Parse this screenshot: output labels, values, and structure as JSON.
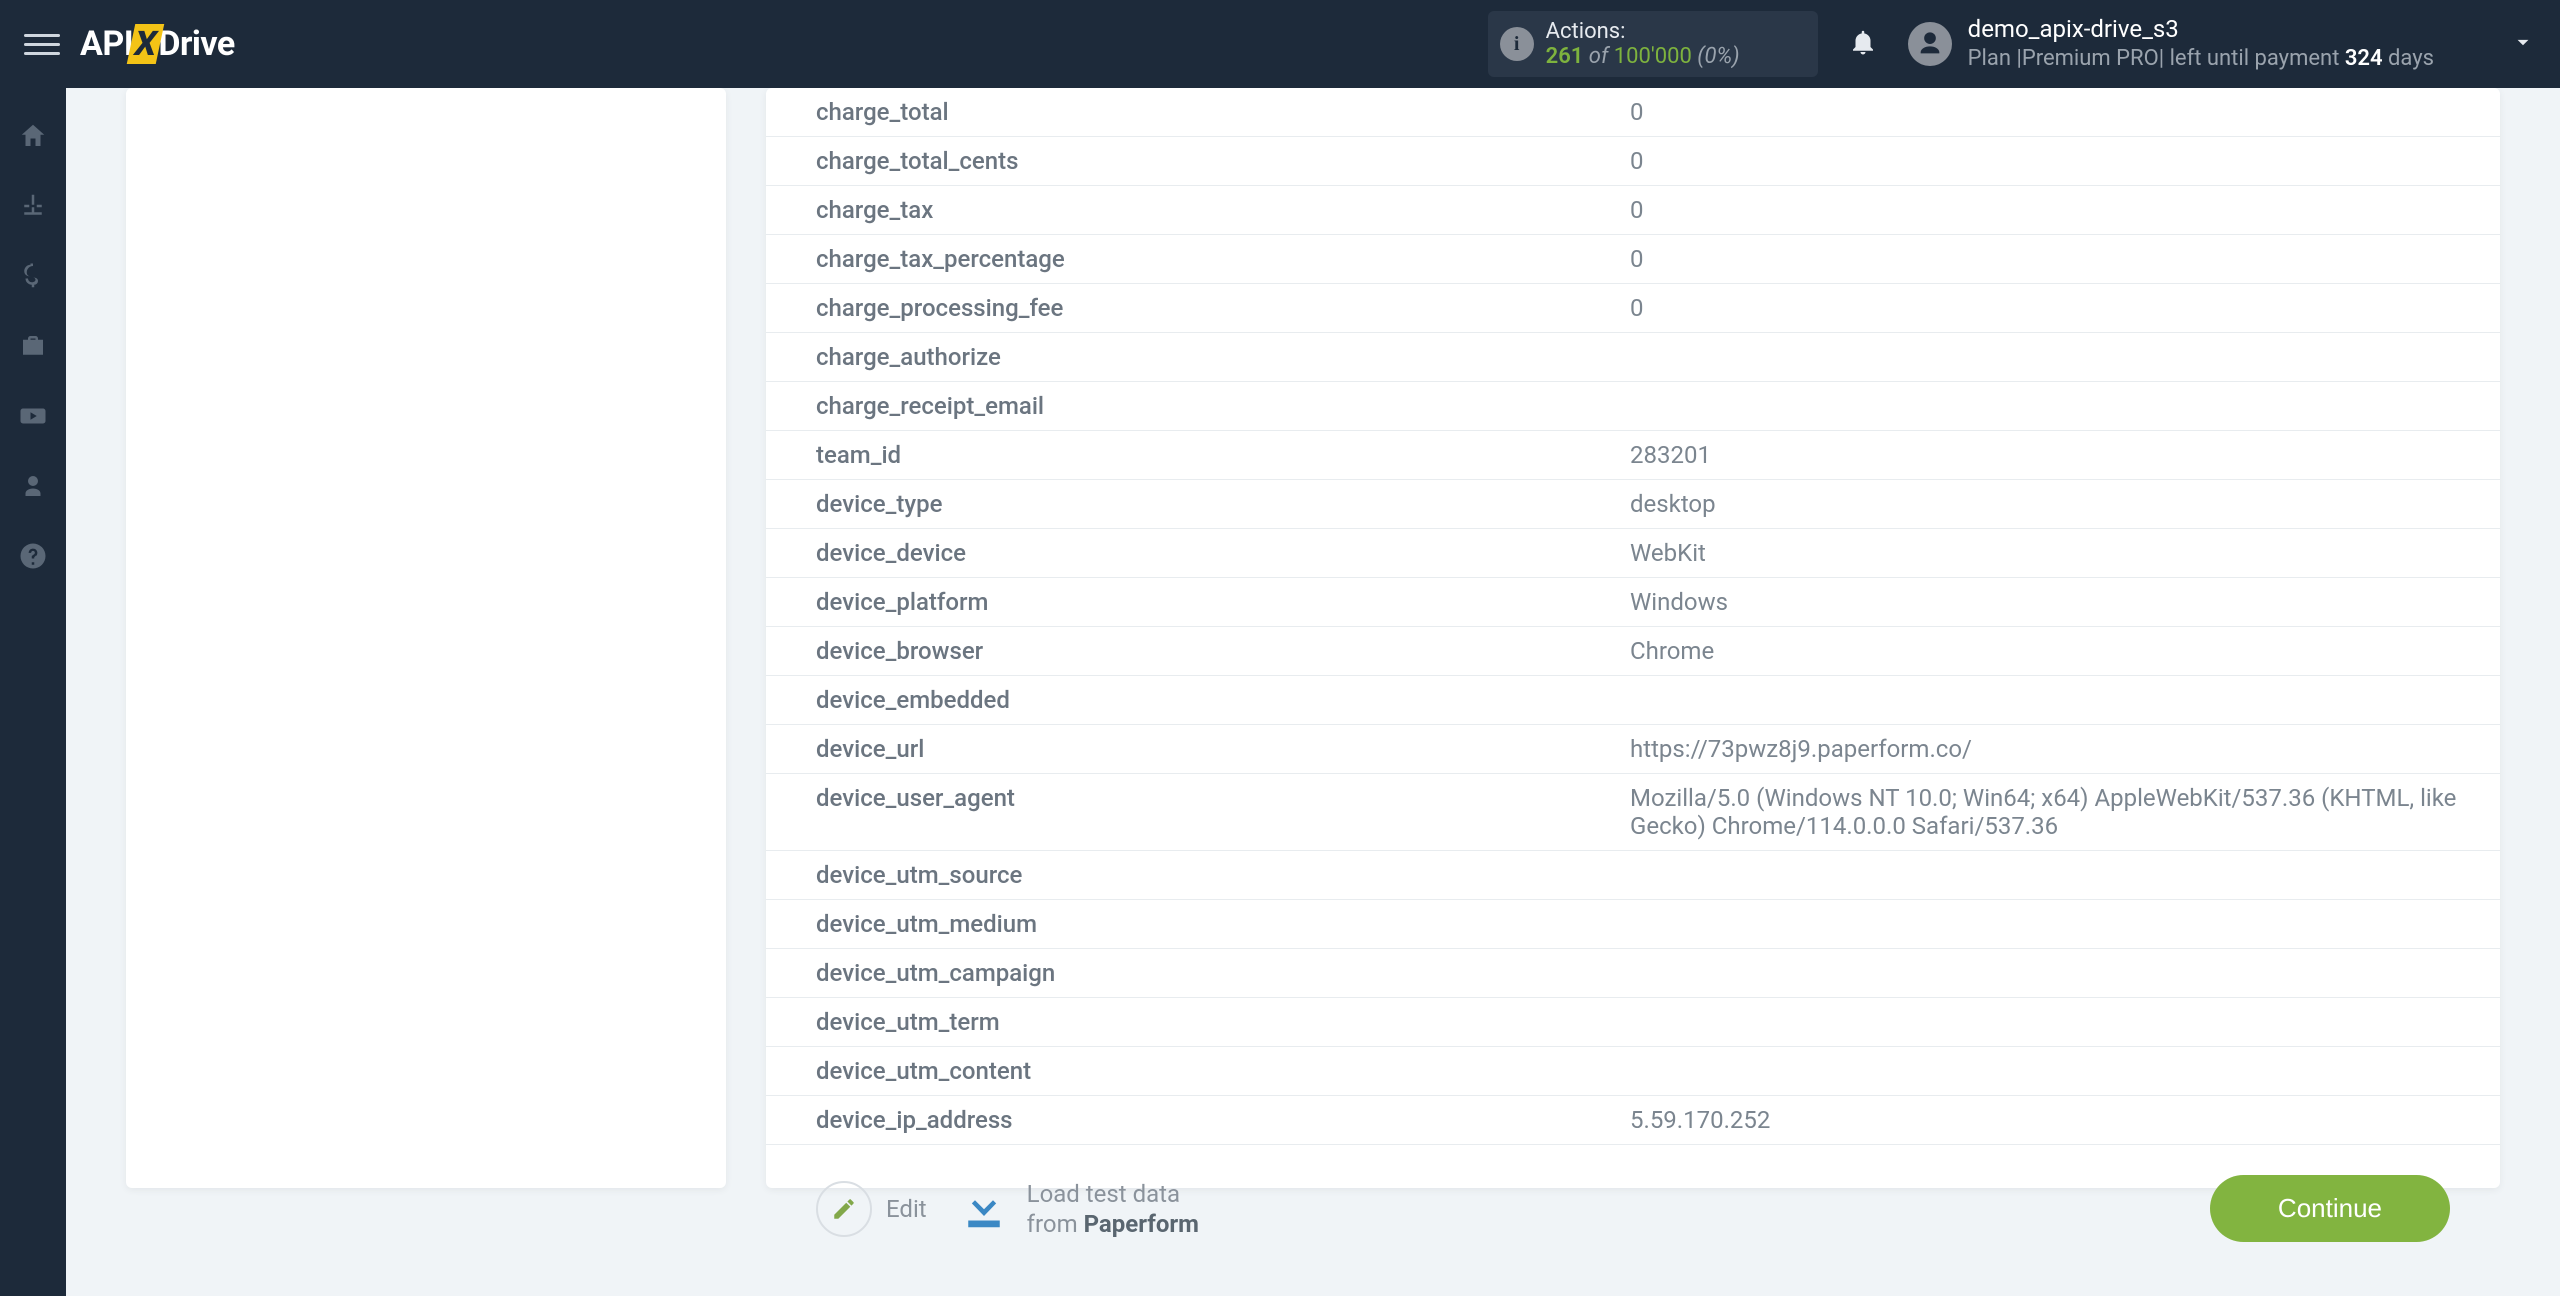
{
  "header": {
    "logo_pre": "API",
    "logo_x": "X",
    "logo_post": "Drive",
    "actions_label": "Actions:",
    "actions_count": "261",
    "actions_of": " of ",
    "actions_total": "100'000",
    "actions_pct": " (0%)",
    "user_name": "demo_apix-drive_s3",
    "plan_prefix": "Plan  |",
    "plan_name": "Premium PRO",
    "plan_mid": "|  left until payment ",
    "plan_days": "324",
    "plan_suffix": " days"
  },
  "rows": [
    {
      "k": "charge_total",
      "v": "0"
    },
    {
      "k": "charge_total_cents",
      "v": "0"
    },
    {
      "k": "charge_tax",
      "v": "0"
    },
    {
      "k": "charge_tax_percentage",
      "v": "0"
    },
    {
      "k": "charge_processing_fee",
      "v": "0"
    },
    {
      "k": "charge_authorize",
      "v": ""
    },
    {
      "k": "charge_receipt_email",
      "v": ""
    },
    {
      "k": "team_id",
      "v": "283201"
    },
    {
      "k": "device_type",
      "v": "desktop"
    },
    {
      "k": "device_device",
      "v": "WebKit"
    },
    {
      "k": "device_platform",
      "v": "Windows"
    },
    {
      "k": "device_browser",
      "v": "Chrome"
    },
    {
      "k": "device_embedded",
      "v": ""
    },
    {
      "k": "device_url",
      "v": "https://73pwz8j9.paperform.co/"
    },
    {
      "k": "device_user_agent",
      "v": "Mozilla/5.0 (Windows NT 10.0; Win64; x64) AppleWebKit/537.36 (KHTML, like Gecko) Chrome/114.0.0.0 Safari/537.36"
    },
    {
      "k": "device_utm_source",
      "v": ""
    },
    {
      "k": "device_utm_medium",
      "v": ""
    },
    {
      "k": "device_utm_campaign",
      "v": ""
    },
    {
      "k": "device_utm_term",
      "v": ""
    },
    {
      "k": "device_utm_content",
      "v": ""
    },
    {
      "k": "device_ip_address",
      "v": "5.59.170.252"
    }
  ],
  "footer": {
    "edit": "Edit",
    "load_line1": "Load test data",
    "load_line2_pre": "from ",
    "load_line2_strong": "Paperform",
    "continue": "Continue"
  }
}
